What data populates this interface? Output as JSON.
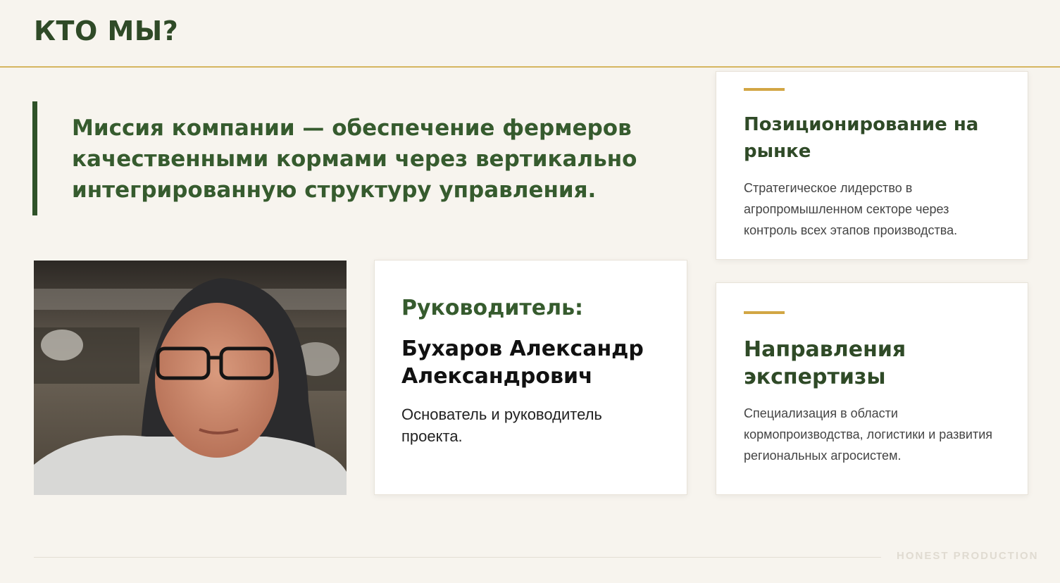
{
  "header": {
    "title": "КТО МЫ?"
  },
  "mission": {
    "text": "Миссия компании — обеспечение фермеров качественными кормами через вертикально интегрированную структуру управления."
  },
  "leader": {
    "label": "Руководитель:",
    "name": "Бухаров Александр Александрович",
    "role": "Основатель и руководитель проекта."
  },
  "cards": [
    {
      "title": "Позиционирование на рынке",
      "description": "Стратегическое лидерство в агропромышленном секторе через контроль всех этапов производства."
    },
    {
      "title": "Направления экспертизы",
      "description": "Специализация в области кормопроизводства, логистики и развития региональных агросистем."
    }
  ],
  "footer": {
    "brand": "HONEST PRODUCTION"
  },
  "colors": {
    "accent": "#d2a644",
    "brand_green": "#2f4a27",
    "background": "#f7f4ee"
  }
}
